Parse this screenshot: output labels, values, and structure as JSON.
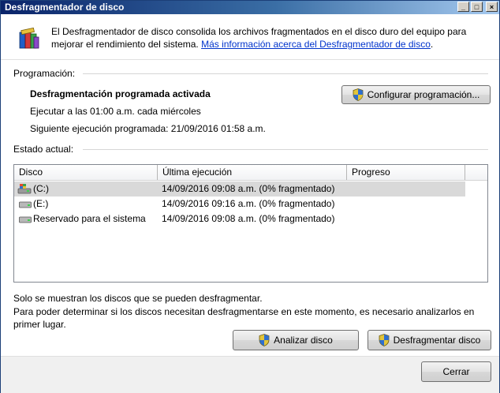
{
  "window": {
    "title": "Desfragmentador de disco",
    "controls": {
      "minimize": "_",
      "maximize": "□",
      "close": "×"
    }
  },
  "intro": {
    "text": "El Desfragmentador de disco consolida los archivos fragmentados en el disco duro del equipo para mejorar el rendimiento del sistema. ",
    "link": "Más información acerca del Desfragmentador de disco",
    "suffix": "."
  },
  "schedule": {
    "label": "Programación:",
    "status": "Desfragmentación programada activada",
    "run_at": "Ejecutar a las 01:00 a.m. cada miércoles",
    "next_run": "Siguiente ejecución programada: 21/09/2016 01:58 a.m.",
    "configure_button": "Configurar programación..."
  },
  "current_state": {
    "label": "Estado actual:",
    "columns": [
      "Disco",
      "Última ejecución",
      "Progreso"
    ],
    "disks": [
      {
        "name": "(C:)",
        "last_run": "14/09/2016 09:08 a.m. (0% fragmentado)",
        "progress": "",
        "icon": "system-drive-icon",
        "selected": true
      },
      {
        "name": "(E:)",
        "last_run": "14/09/2016 09:16 a.m. (0% fragmentado)",
        "progress": "",
        "icon": "drive-icon",
        "selected": false
      },
      {
        "name": "Reservado para el sistema",
        "last_run": "14/09/2016 09:08 a.m. (0% fragmentado)",
        "progress": "",
        "icon": "drive-icon",
        "selected": false
      }
    ]
  },
  "notes": {
    "line1": "Solo se muestran los discos que se pueden desfragmentar.",
    "line2": "Para poder determinar si los discos necesitan desfragmentarse en este momento, es necesario analizarlos en primer lugar."
  },
  "actions": {
    "analyze_button": "Analizar disco",
    "defrag_button": "Desfragmentar disco",
    "close_button": "Cerrar"
  },
  "colors": {
    "titlebar_start": "#0a246a",
    "titlebar_end": "#a6caf0",
    "link": "#0033cc",
    "selected_row": "#d9d9d9"
  }
}
